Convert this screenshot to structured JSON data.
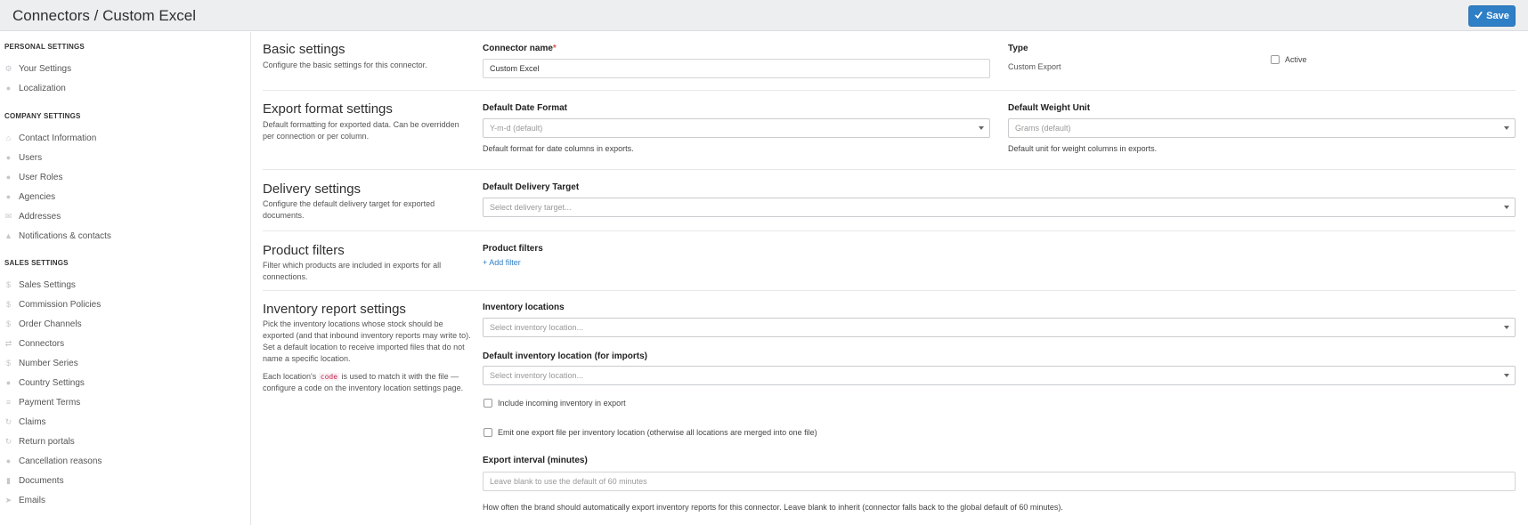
{
  "header": {
    "title": "Connectors / Custom Excel",
    "save_label": "Save"
  },
  "sidebar": {
    "sections": [
      {
        "title": "PERSONAL SETTINGS",
        "items": [
          {
            "label": "Your Settings",
            "icon": "gear-icon"
          },
          {
            "label": "Localization",
            "icon": "globe-icon"
          }
        ]
      },
      {
        "title": "COMPANY SETTINGS",
        "items": [
          {
            "label": "Contact Information",
            "icon": "home-icon"
          },
          {
            "label": "Users",
            "icon": "user-icon"
          },
          {
            "label": "User Roles",
            "icon": "user-roles-icon"
          },
          {
            "label": "Agencies",
            "icon": "agency-icon"
          },
          {
            "label": "Addresses",
            "icon": "envelope-icon"
          },
          {
            "label": "Notifications & contacts",
            "icon": "bell-icon"
          }
        ]
      },
      {
        "title": "SALES SETTINGS",
        "items": [
          {
            "label": "Sales Settings",
            "icon": "dollar-icon"
          },
          {
            "label": "Commission Policies",
            "icon": "dollar-icon"
          },
          {
            "label": "Order Channels",
            "icon": "dollar-icon"
          },
          {
            "label": "Connectors",
            "icon": "exchange-icon"
          },
          {
            "label": "Number Series",
            "icon": "dollar-icon"
          },
          {
            "label": "Country Settings",
            "icon": "map-marker-icon"
          },
          {
            "label": "Payment Terms",
            "icon": "list-icon"
          },
          {
            "label": "Claims",
            "icon": "refresh-icon"
          },
          {
            "label": "Return portals",
            "icon": "refresh-icon"
          },
          {
            "label": "Cancellation reasons",
            "icon": "question-icon"
          },
          {
            "label": "Documents",
            "icon": "document-icon"
          },
          {
            "label": "Emails",
            "icon": "paper-plane-icon"
          }
        ]
      }
    ]
  },
  "basic": {
    "title": "Basic settings",
    "desc": "Configure the basic settings for this connector.",
    "name_label": "Connector name",
    "required_mark": "*",
    "name_value": "Custom Excel",
    "type_label": "Type",
    "type_value": "Custom Export",
    "active_label": "Active"
  },
  "export_format": {
    "title": "Export format settings",
    "desc": "Default formatting for exported data. Can be overridden per connection or per column.",
    "date_label": "Default Date Format",
    "date_value": "Y-m-d (default)",
    "date_help": "Default format for date columns in exports.",
    "weight_label": "Default Weight Unit",
    "weight_value": "Grams (default)",
    "weight_help": "Default unit for weight columns in exports."
  },
  "delivery": {
    "title": "Delivery settings",
    "desc": "Configure the default delivery target for exported documents.",
    "target_label": "Default Delivery Target",
    "target_placeholder": "Select delivery target..."
  },
  "product_filters": {
    "title": "Product filters",
    "desc": "Filter which products are included in exports for all connections.",
    "label": "Product filters",
    "add_label": "Add filter"
  },
  "inventory": {
    "title": "Inventory report settings",
    "desc1": "Pick the inventory locations whose stock should be exported (and that inbound inventory reports may write to). Set a default location to receive imported files that do not name a specific location.",
    "desc2_pre": "Each location's",
    "desc2_code": "code",
    "desc2_post": "is used to match it with the file — configure a code on the inventory location settings page.",
    "locations_label": "Inventory locations",
    "locations_placeholder": "Select inventory location...",
    "default_label": "Default inventory location (for imports)",
    "default_placeholder": "Select inventory location...",
    "incoming_label": "Include incoming inventory in export",
    "per_location_label": "Emit one export file per inventory location (otherwise all locations are merged into one file)",
    "interval_label": "Export interval (minutes)",
    "interval_placeholder": "Leave blank to use the default of 60 minutes",
    "interval_help": "How often the brand should automatically export inventory reports for this connector. Leave blank to inherit (connector falls back to the global default of 60 minutes)."
  }
}
